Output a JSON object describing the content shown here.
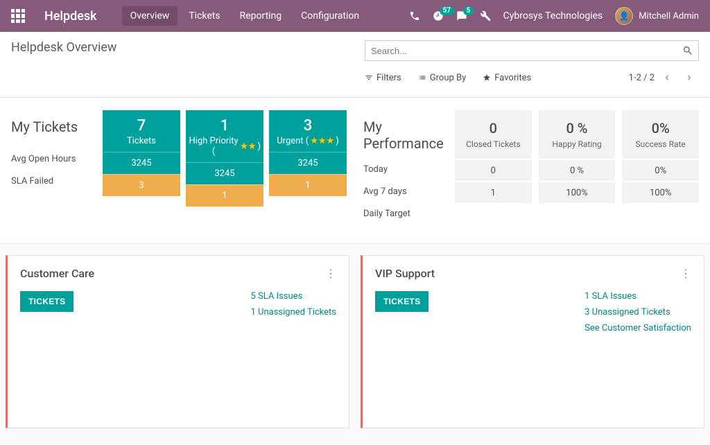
{
  "nav": {
    "brand": "Helpdesk",
    "menu": [
      "Overview",
      "Tickets",
      "Reporting",
      "Configuration"
    ],
    "timer_badge": "57",
    "msg_badge": "5",
    "company": "Cybrosys Technologies",
    "user": "Mitchell Admin"
  },
  "cp": {
    "title": "Helpdesk Overview",
    "search_placeholder": "Search...",
    "filters": "Filters",
    "groupby": "Group By",
    "favorites": "Favorites",
    "pager": "1-2 / 2"
  },
  "tickets": {
    "title": "My Tickets",
    "rows": [
      "Avg Open Hours",
      "SLA Failed"
    ],
    "cards": [
      {
        "big": "7",
        "sub": "Tickets",
        "stars": 0,
        "avg": "3245",
        "sla": "3"
      },
      {
        "big": "1",
        "sub": "High Priority (",
        "stars": 2,
        "avg": "3245",
        "sla": "1"
      },
      {
        "big": "3",
        "sub": "Urgent (",
        "stars": 3,
        "avg": "3245",
        "sla": "1"
      }
    ]
  },
  "perf": {
    "title": "My Performance",
    "rows": [
      "Today",
      "Avg 7 days",
      "Daily Target"
    ],
    "cards": [
      {
        "big": "0",
        "sub": "Closed Tickets",
        "r1": "0",
        "r2": "1"
      },
      {
        "big": "0 %",
        "sub": "Happy Rating",
        "r1": "0 %",
        "r2": "100%"
      },
      {
        "big": "0%",
        "sub": "Success Rate",
        "r1": "0%",
        "r2": "100%"
      }
    ]
  },
  "teams": [
    {
      "title": "Customer Care",
      "btn": "TICKETS",
      "links": [
        "5 SLA Issues",
        "1 Unassigned Tickets"
      ]
    },
    {
      "title": "VIP Support",
      "btn": "TICKETS",
      "links": [
        "1 SLA Issues",
        "3 Unassigned Tickets",
        "See Customer Satisfaction"
      ]
    }
  ]
}
